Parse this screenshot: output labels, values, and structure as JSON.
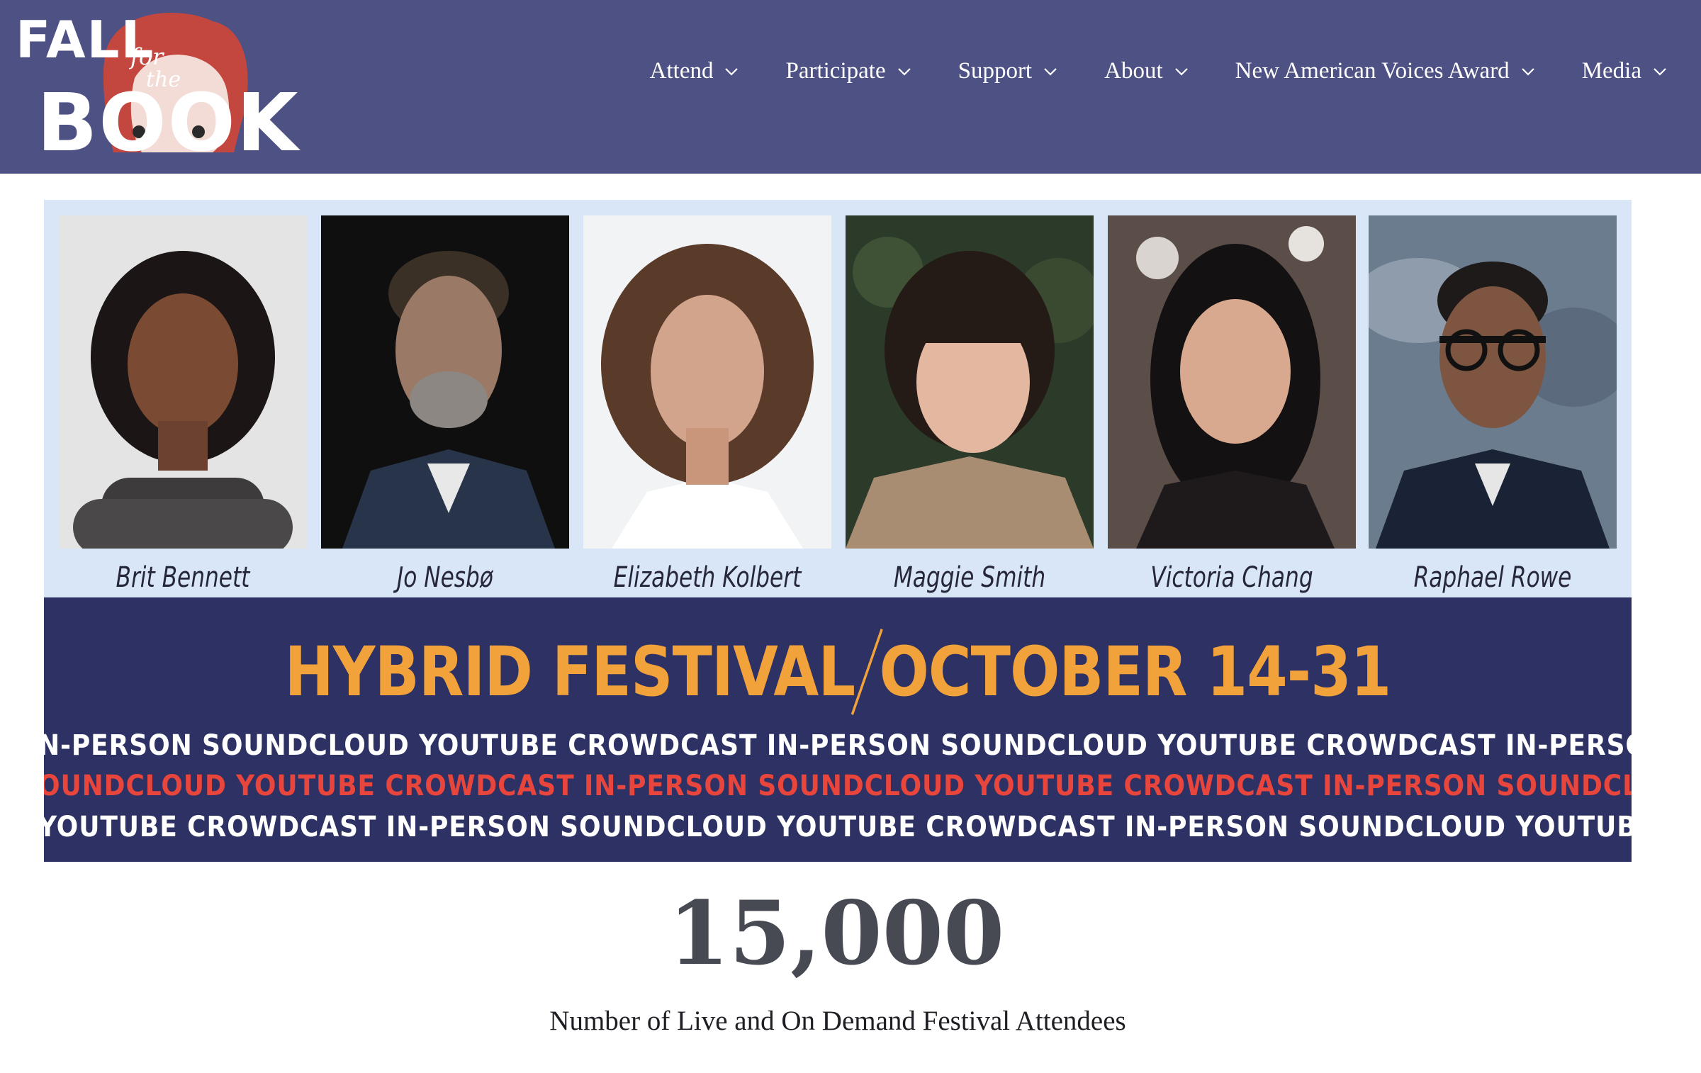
{
  "header": {
    "logo": {
      "line1": "FALL",
      "for_word": "for",
      "the_word": "the",
      "line2": "BOOK"
    },
    "nav": [
      {
        "label": "Attend"
      },
      {
        "label": "Participate"
      },
      {
        "label": "Support"
      },
      {
        "label": "About"
      },
      {
        "label": "New American Voices Award"
      },
      {
        "label": "Media"
      }
    ],
    "colors": {
      "header_bg": "#4e5184",
      "logo_red": "#c4473f"
    }
  },
  "banner": {
    "authors": [
      {
        "name": "Brit Bennett"
      },
      {
        "name": "Jo Nesbø"
      },
      {
        "name": "Elizabeth Kolbert"
      },
      {
        "name": "Maggie Smith"
      },
      {
        "name": "Victoria Chang"
      },
      {
        "name": "Raphael Rowe"
      }
    ],
    "festival_left": "HYBRID FESTIVAL",
    "festival_right": "OCTOBER 14-31",
    "marquee": {
      "row1": "N-PERSON SOUNDCLOUD YOUTUBE CROWDCAST IN-PERSON SOUNDCLOUD YOUTUBE CROWDCAST IN-PERSON S",
      "row2": "OUNDCLOUD YOUTUBE CROWDCAST IN-PERSON SOUNDCLOUD YOUTUBE CROWDCAST IN-PERSON SOUNDCLOU",
      "row3": "YOUTUBE CROWDCAST IN-PERSON SOUNDCLOUD YOUTUBE CROWDCAST IN-PERSON SOUNDCLOUD YOUTUBE CR"
    },
    "colors": {
      "band_bg": "#2d3163",
      "title": "#f2a23a",
      "accent_red": "#e8453c"
    }
  },
  "stats": {
    "number": "15,000",
    "label": "Number of Live and On Demand Festival Attendees"
  }
}
